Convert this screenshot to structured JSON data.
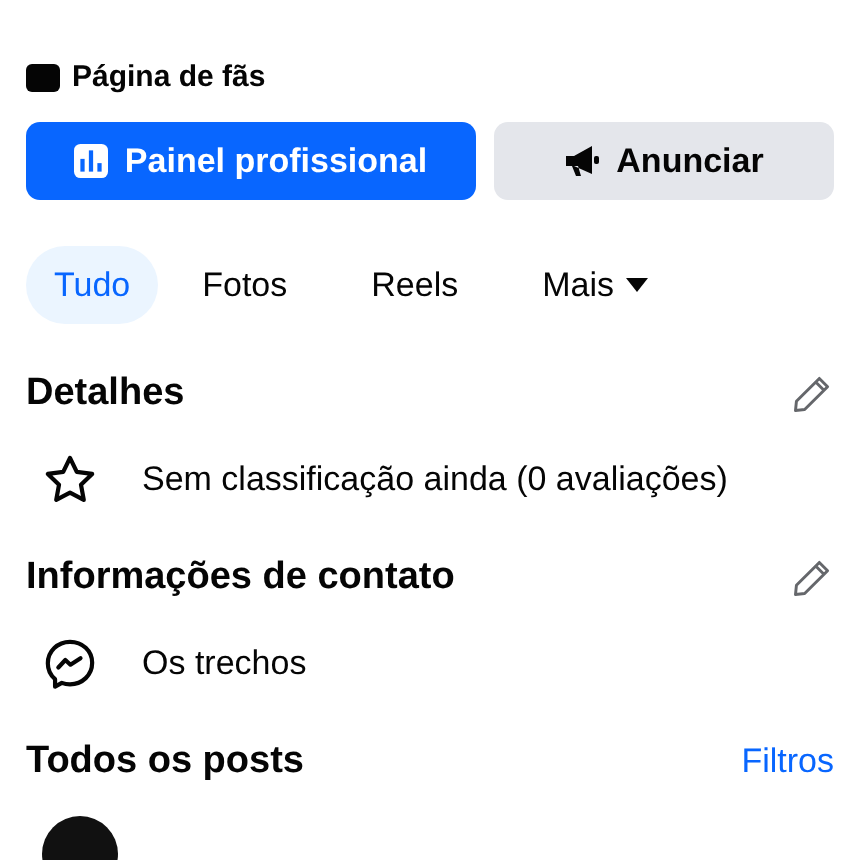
{
  "page_type": {
    "label": "Página de fãs"
  },
  "buttons": [
    {
      "kind": "primary",
      "label": "Painel profissional"
    },
    {
      "kind": "secondary",
      "label": "Anunciar"
    }
  ],
  "tabs": [
    {
      "label": "Tudo",
      "selected": true,
      "dropdown": false
    },
    {
      "label": "Fotos",
      "selected": false,
      "dropdown": false
    },
    {
      "label": "Reels",
      "selected": false,
      "dropdown": false
    },
    {
      "label": "Mais",
      "selected": false,
      "dropdown": true
    }
  ],
  "sections": [
    {
      "title": "Detalhes",
      "editable": true,
      "rows": [
        {
          "kind": "rating",
          "text": "Sem classificação ainda (0 avaliações)"
        }
      ]
    },
    {
      "title": "Informações de contato",
      "editable": true,
      "rows": [
        {
          "kind": "messenger",
          "text": "Os trechos"
        }
      ]
    }
  ],
  "posts_header": {
    "title": "Todos os posts",
    "action": "Filtros"
  }
}
